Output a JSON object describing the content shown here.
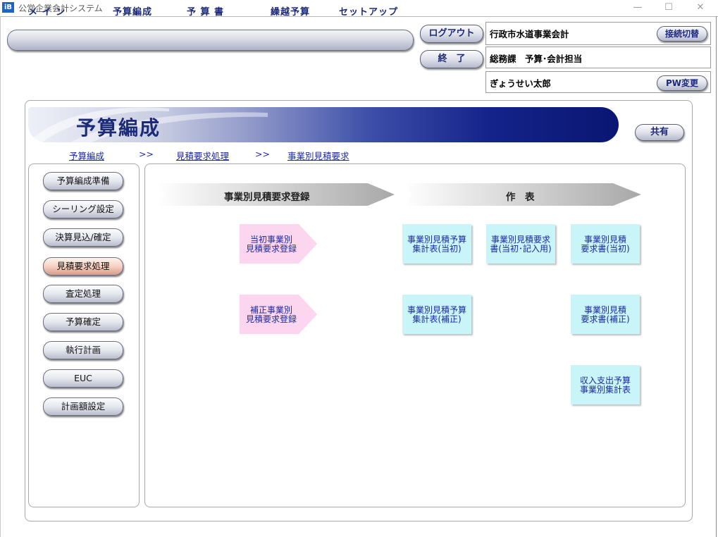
{
  "window": {
    "app_icon_text": "iB",
    "title": "公営企業会計システム",
    "controls": {
      "minimize": "—",
      "maximize": "☐",
      "close": "✕"
    }
  },
  "menu": {
    "items": [
      "メ イ ン",
      "予算編成",
      "予 算 書",
      "繰越予算",
      "セットアップ"
    ]
  },
  "buttons": {
    "logout": "ログアウト",
    "exit": "終　了",
    "connect_switch": "接続切替",
    "pw_change": "PW変更",
    "share": "共有"
  },
  "user_info": {
    "organization": "行政市水道事業会計",
    "department": "総務課　予算･会計担当",
    "user_name": "ぎょうせい太郎"
  },
  "page": {
    "title": "予算編成"
  },
  "breadcrumb": {
    "items": [
      "予算編成",
      "見積要求処理",
      "事業別見積要求"
    ],
    "separator": ">>"
  },
  "sidebar": {
    "items": [
      {
        "label": "予算編成準備",
        "active": false
      },
      {
        "label": "シーリング設定",
        "active": false
      },
      {
        "label": "決算見込/確定",
        "active": false
      },
      {
        "label": "見積要求処理",
        "active": true
      },
      {
        "label": "査定処理",
        "active": false
      },
      {
        "label": "予算確定",
        "active": false
      },
      {
        "label": "執行計画",
        "active": false
      },
      {
        "label": "EUC",
        "active": false
      },
      {
        "label": "計画額設定",
        "active": false
      }
    ]
  },
  "sections": {
    "registration": "事業別見積要求登録",
    "reports": "作　表"
  },
  "registration_items": [
    "当初事業別\n見積要求登録",
    "補正事業別\n見積要求登録"
  ],
  "report_items": [
    "事業別見積予算\n集計表(当初)",
    "事業別見積要求\n書(当初･記入用)",
    "事業別見積\n要求書(当初)",
    "事業別見積予算\n集計表(補正)",
    "事業別見積\n要求書(補正)",
    "収入支出予算\n事業別集計表"
  ],
  "colors": {
    "menu_text": "#1c2a7a",
    "link": "#1c2a9a",
    "pink_box": "#fcd5ee",
    "cyan_box": "#c9f4f8",
    "banner_dark": "#0a1672"
  }
}
